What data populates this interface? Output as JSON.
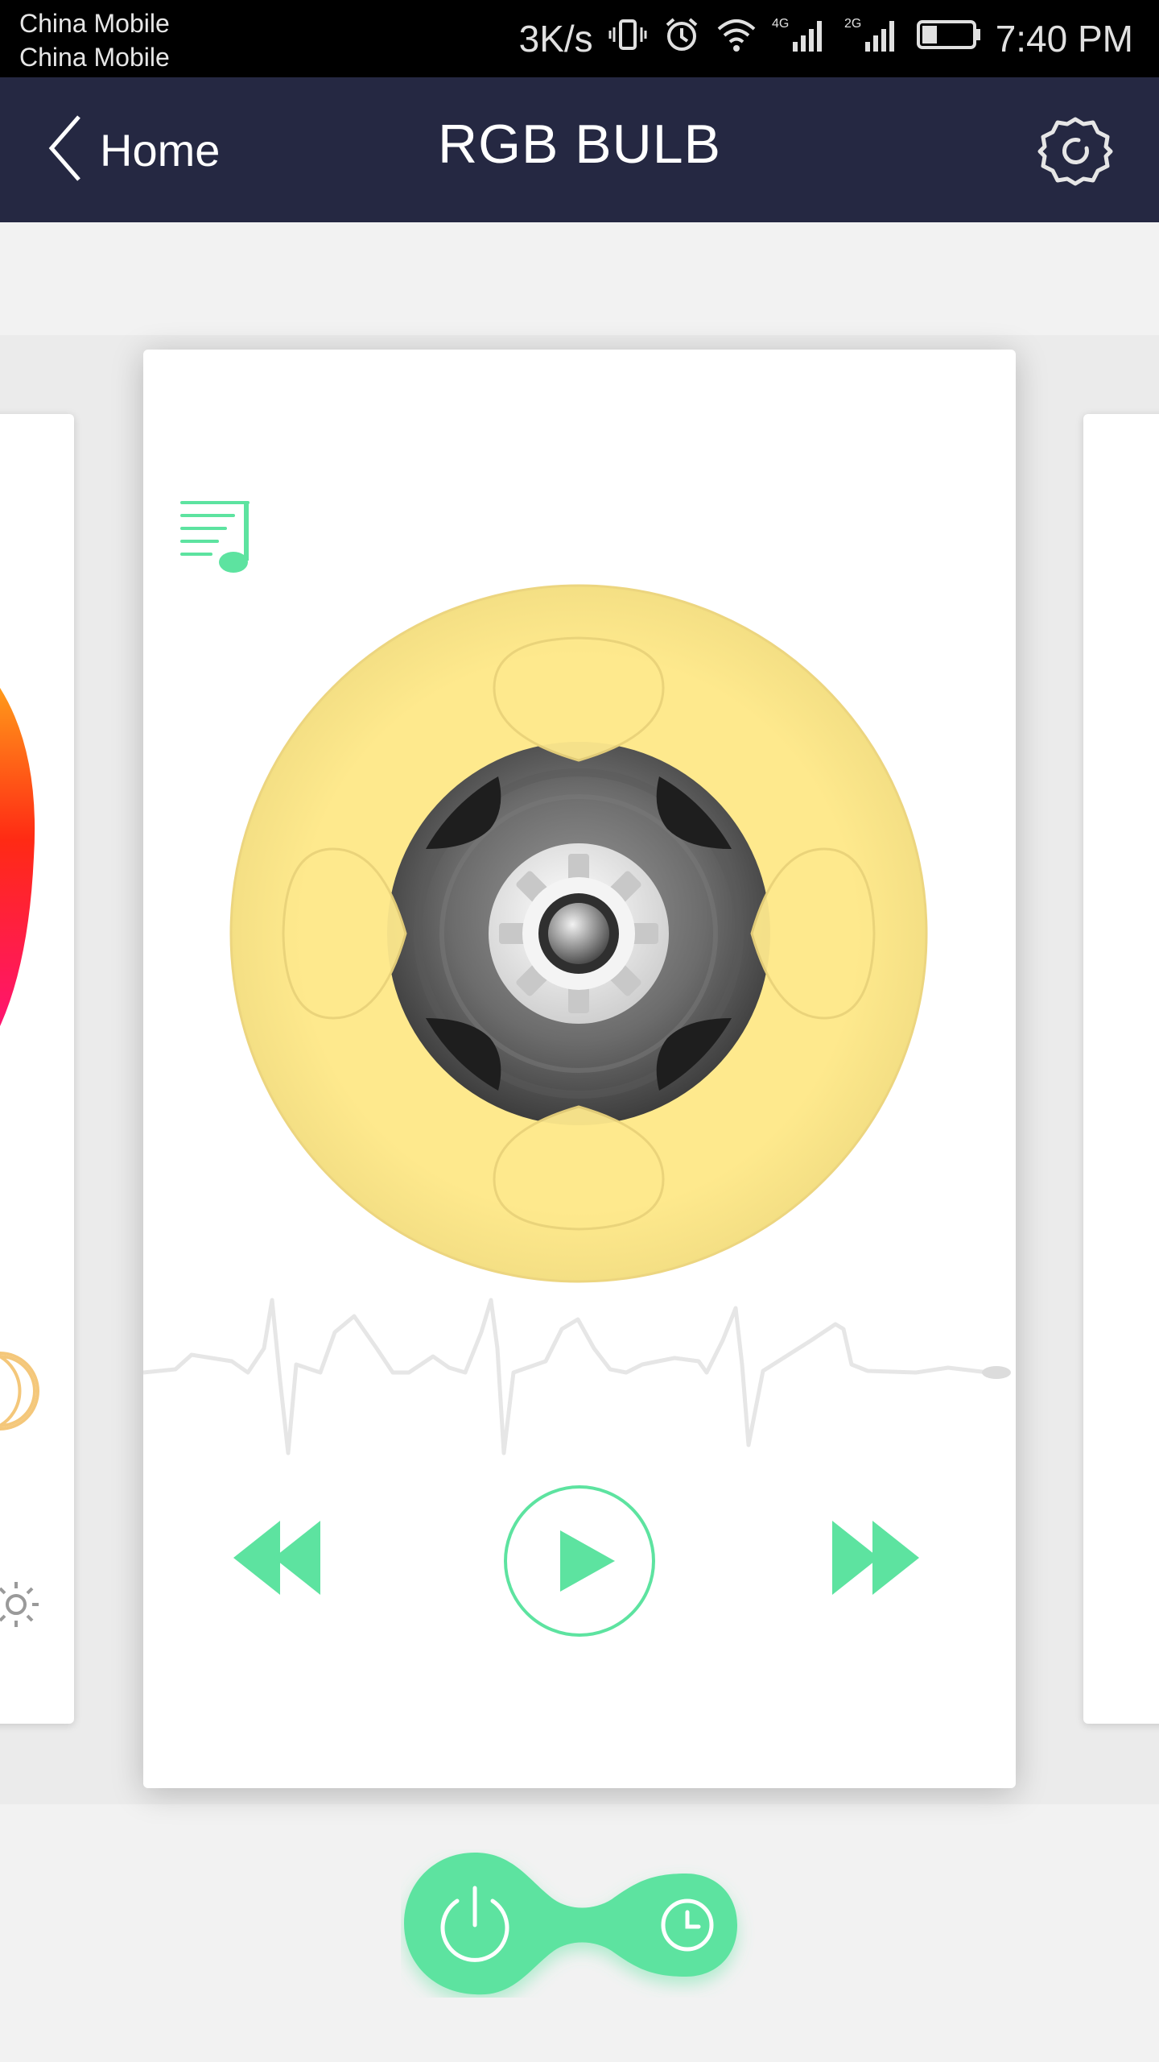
{
  "status_bar": {
    "carrier_1": "China Mobile",
    "carrier_2": "China Mobile",
    "net_speed": "3K/s",
    "net_4g": "4G",
    "net_2g": "2G",
    "time": "7:40 PM",
    "battery_level": 0.3,
    "icons": [
      "vibrate-icon",
      "alarm-icon",
      "wifi-icon",
      "signal-4g-icon",
      "signal-2g-icon",
      "battery-icon"
    ]
  },
  "nav": {
    "back_label": "Home",
    "title": "RGB BULB",
    "settings_icon": "gear-icon"
  },
  "music_card": {
    "playlist_icon": "playlist-music-icon",
    "reel_color": "#fde98c",
    "controls": [
      "rewind-icon",
      "play-icon",
      "fast-forward-icon"
    ]
  },
  "bottom_bar": {
    "icons": [
      "power-icon",
      "clock-icon"
    ]
  },
  "colors": {
    "status_bar_bg": "#000000",
    "nav_bg": "#252842",
    "accent_green": "#5de3a0",
    "page_bg": "#f2f2f2"
  }
}
